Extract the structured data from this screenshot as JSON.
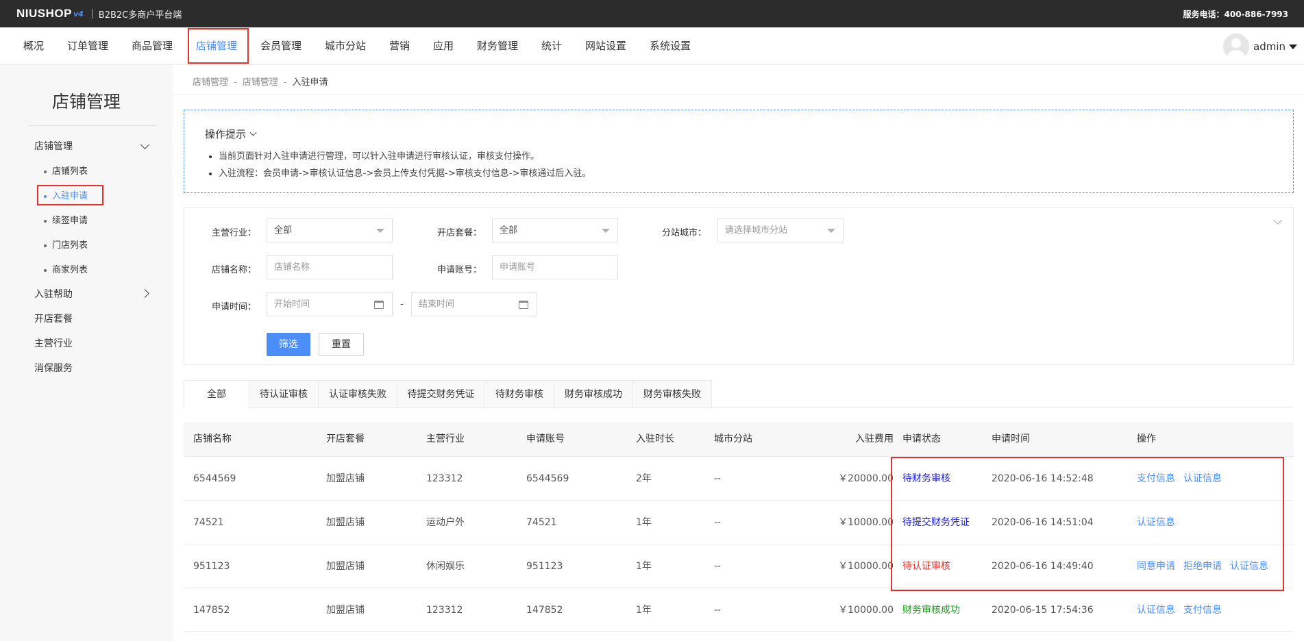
{
  "topbar": {
    "logo": "NIUSHOP",
    "logo_version": "v4",
    "subtitle": "B2B2C多商户平台端",
    "phone": "服务电话：400-886-7993"
  },
  "nav": {
    "items": [
      "概况",
      "订单管理",
      "商品管理",
      "店铺管理",
      "会员管理",
      "城市分站",
      "营销",
      "应用",
      "财务管理",
      "统计",
      "网站设置",
      "系统设置"
    ],
    "active": "店铺管理",
    "user": "admin"
  },
  "sidebar": {
    "title": "店铺管理",
    "group": "店铺管理",
    "sub_items": [
      "店铺列表",
      "入驻申请",
      "续签申请",
      "门店列表",
      "商家列表"
    ],
    "active": "入驻申请",
    "links": [
      "入驻帮助",
      "开店套餐",
      "主营行业",
      "消保服务"
    ]
  },
  "breadcrumb": [
    "店铺管理",
    "店铺管理",
    "入驻申请"
  ],
  "breadcrumb_sep": "-",
  "tips": {
    "title": "操作提示",
    "lines": [
      "当前页面针对入驻申请进行管理，可以针入驻申请进行审核认证，审核支付操作。",
      "入驻流程：会员申请->审核认证信息->会员上传支付凭据->审核支付信息->审核通过后入驻。"
    ]
  },
  "filter": {
    "industry_label": "主营行业：",
    "industry_value": "全部",
    "package_label": "开店套餐：",
    "package_value": "全部",
    "city_label": "分站城市：",
    "city_placeholder": "请选择城市分站",
    "shop_name_label": "店铺名称：",
    "shop_name_placeholder": "店铺名称",
    "account_label": "申请账号：",
    "account_placeholder": "申请账号",
    "time_label": "申请时间：",
    "start_placeholder": "开始时间",
    "end_placeholder": "结束时间",
    "dash": "-",
    "filter_button": "筛选",
    "reset_button": "重置"
  },
  "tabs": [
    "全部",
    "待认证审核",
    "认证审核失败",
    "待提交财务凭证",
    "待财务审核",
    "财务审核成功",
    "财务审核失败"
  ],
  "active_tab": "全部",
  "table": {
    "headers": [
      "店铺名称",
      "开店套餐",
      "主营行业",
      "申请账号",
      "入驻时长",
      "城市分站",
      "入驻费用",
      "申请状态",
      "申请时间",
      "操作"
    ],
    "rows": [
      {
        "name": "6544569",
        "package": "加盟店铺",
        "industry": "123312",
        "account": "6544569",
        "duration": "2年",
        "city": "--",
        "fee": "￥20000.00",
        "status": "待财务审核",
        "status_color": "#1a1adb",
        "time": "2020-06-16 14:52:48",
        "ops": [
          "支付信息",
          "认证信息"
        ]
      },
      {
        "name": "74521",
        "package": "加盟店铺",
        "industry": "运动户外",
        "account": "74521",
        "duration": "1年",
        "city": "--",
        "fee": "￥10000.00",
        "status": "待提交财务凭证",
        "status_color": "#1a1adb",
        "time": "2020-06-16 14:51:04",
        "ops": [
          "认证信息"
        ]
      },
      {
        "name": "951123",
        "package": "加盟店铺",
        "industry": "休闲娱乐",
        "account": "951123",
        "duration": "1年",
        "city": "--",
        "fee": "￥10000.00",
        "status": "待认证审核",
        "status_color": "#e5322d",
        "time": "2020-06-16 14:49:40",
        "ops": [
          "同意申请",
          "拒绝申请",
          "认证信息"
        ]
      },
      {
        "name": "147852",
        "package": "加盟店铺",
        "industry": "123312",
        "account": "147852",
        "duration": "1年",
        "city": "--",
        "fee": "￥10000.00",
        "status": "财务审核成功",
        "status_color": "#1e9a1e",
        "time": "2020-06-15 17:54:36",
        "ops": [
          "认证信息",
          "支付信息"
        ]
      }
    ]
  },
  "colors": {
    "accent": "#4b8ef7",
    "highlight": "#e5322d",
    "topbar_bg": "#2c2c2c"
  }
}
